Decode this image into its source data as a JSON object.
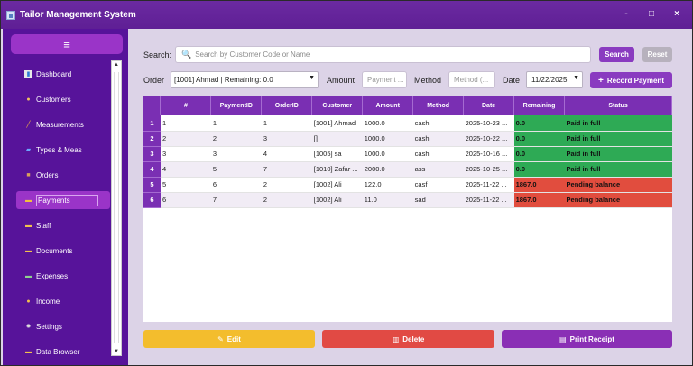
{
  "window": {
    "title": "Tailor Management System",
    "controls": [
      "-",
      "□",
      "×"
    ]
  },
  "sidebar": {
    "menu_icon": "≡",
    "items": [
      {
        "label": "Dashboard",
        "icon": "chart-icon"
      },
      {
        "label": "Customers",
        "icon": "people-icon"
      },
      {
        "label": "Measurements",
        "icon": "ruler-icon"
      },
      {
        "label": "Types & Meas",
        "icon": "thread-icon"
      },
      {
        "label": "Orders",
        "icon": "box-icon"
      },
      {
        "label": "Payments",
        "icon": "card-icon",
        "active": true
      },
      {
        "label": "Staff",
        "icon": "folder-icon"
      },
      {
        "label": "Documents",
        "icon": "folder-icon"
      },
      {
        "label": "Expenses",
        "icon": "money-icon"
      },
      {
        "label": "Income",
        "icon": "coin-icon"
      },
      {
        "label": "Settings",
        "icon": "gear-icon"
      },
      {
        "label": "Data Browser",
        "icon": "folder-icon"
      }
    ]
  },
  "search": {
    "label": "Search:",
    "placeholder": "Search by Customer Code or Name",
    "search_button": "Search",
    "reset_button": "Reset"
  },
  "form": {
    "order_label": "Order",
    "order_value": "[1001] Ahmad | Remaining: 0.0",
    "amount_label": "Amount",
    "amount_placeholder": "Payment ...",
    "method_label": "Method",
    "method_placeholder": "Method (...",
    "date_label": "Date",
    "date_value": "11/22/2025",
    "record_button": "Record Payment"
  },
  "table": {
    "columns": [
      "#",
      "PaymentID",
      "OrderID",
      "Customer",
      "Amount",
      "Method",
      "Date",
      "Remaining",
      "Status"
    ],
    "rows": [
      {
        "n": "1",
        "id": "1",
        "pid": "1",
        "order": "1",
        "customer": "[1001] Ahmad",
        "amount": "1000.0",
        "method": "cash",
        "date": "2025-10-23 ...",
        "remaining": "0.0",
        "status": "Paid in full",
        "state": "paid"
      },
      {
        "n": "2",
        "id": "2",
        "pid": "2",
        "order": "3",
        "customer": "[]",
        "amount": "1000.0",
        "method": "cash",
        "date": "2025-10-22 ...",
        "remaining": "0.0",
        "status": "Paid in full",
        "state": "paid"
      },
      {
        "n": "3",
        "id": "3",
        "pid": "3",
        "order": "4",
        "customer": "[1005] sa",
        "amount": "1000.0",
        "method": "cash",
        "date": "2025-10-16 ...",
        "remaining": "0.0",
        "status": "Paid in full",
        "state": "paid"
      },
      {
        "n": "4",
        "id": "4",
        "pid": "5",
        "order": "7",
        "customer": "[1010] Zafar ...",
        "amount": "2000.0",
        "method": "ass",
        "date": "2025-10-25 ...",
        "remaining": "0.0",
        "status": "Paid in full",
        "state": "paid"
      },
      {
        "n": "5",
        "id": "5",
        "pid": "6",
        "order": "2",
        "customer": "[1002] Ali",
        "amount": "122.0",
        "method": "casf",
        "date": "2025-11-22 ...",
        "remaining": "1867.0",
        "status": "Pending balance",
        "state": "pending"
      },
      {
        "n": "6",
        "id": "6",
        "pid": "7",
        "order": "2",
        "customer": "[1002] Ali",
        "amount": "11.0",
        "method": "sad",
        "date": "2025-11-22 ...",
        "remaining": "1867.0",
        "status": "Pending balance",
        "state": "pending"
      }
    ]
  },
  "actions": {
    "edit": "Edit",
    "delete": "Delete",
    "print": "Print Receipt"
  }
}
